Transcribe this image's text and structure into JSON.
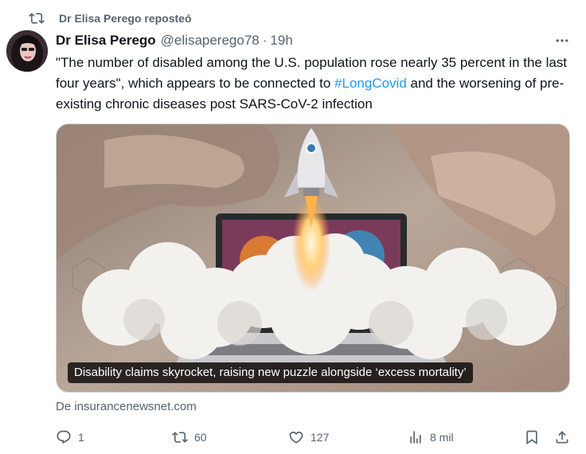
{
  "repost": {
    "label": "Dr Elisa Perego reposteó",
    "icon": "repost-icon"
  },
  "author": {
    "name": "Dr Elisa Perego",
    "handle": "@elisaperego78",
    "separator": "·",
    "time": "19h"
  },
  "tweet": {
    "text_before": "\"The number of disabled among the U.S. population rose nearly 35 percent in the last four years\", which appears to be connected to ",
    "hashtag": "#LongCovid",
    "text_after": " and the worsening of pre-existing chronic diseases post SARS-CoV-2 infection"
  },
  "card": {
    "caption": "Disability claims skyrocket, raising new puzzle alongside ‘excess mortality’"
  },
  "source": "De insurancenewsnet.com",
  "actions": {
    "reply_count": "1",
    "repost_count": "60",
    "like_count": "127",
    "views_count": "8 mil"
  },
  "colors": {
    "link": "#1d9bf0",
    "muted": "#536471",
    "text": "#0f1419"
  }
}
